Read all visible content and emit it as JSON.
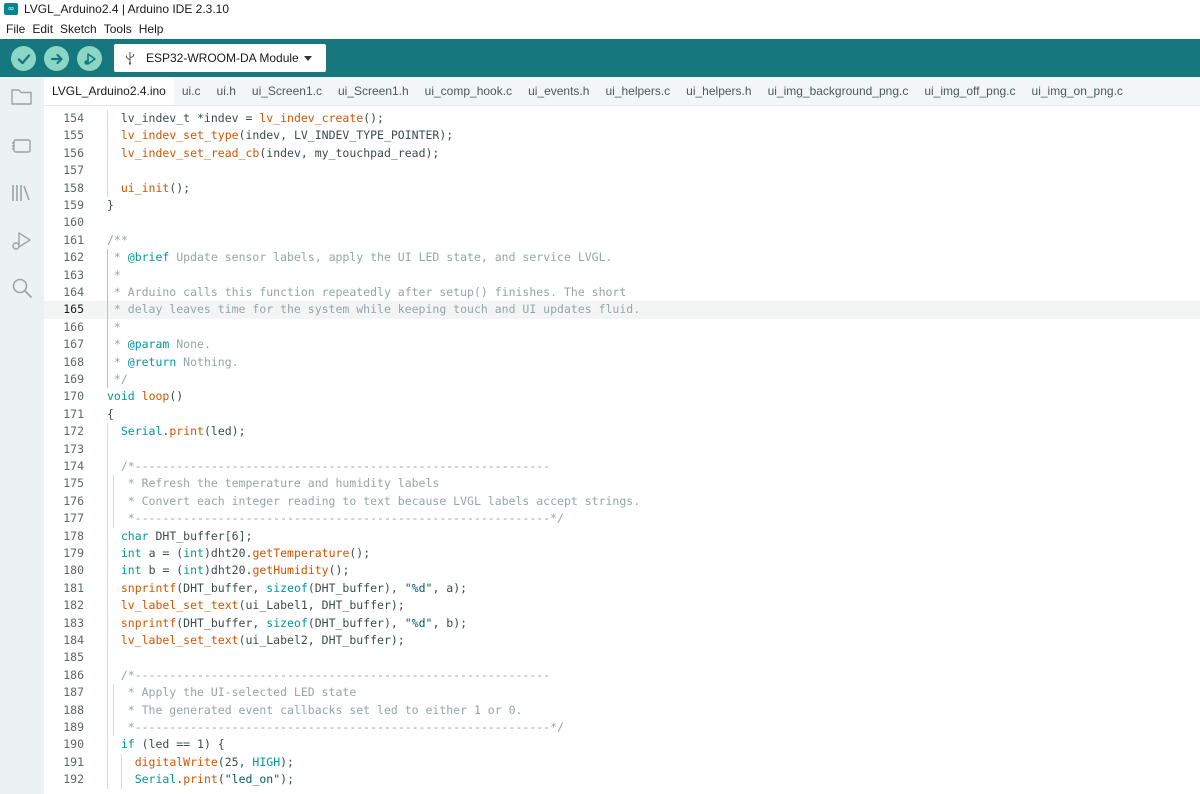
{
  "window": {
    "title": "LVGL_Arduino2.4 | Arduino IDE 2.3.10"
  },
  "menu": [
    "File",
    "Edit",
    "Sketch",
    "Tools",
    "Help"
  ],
  "toolbar": {
    "board": "ESP32-WROOM-DA Module"
  },
  "colors": {
    "toolbar": "#17777f",
    "button": "#8cd6c6",
    "keyword": "#00979d",
    "function": "#d35400",
    "comment": "#95a5a6"
  },
  "tabs": [
    "LVGL_Arduino2.4.ino",
    "ui.c",
    "ui.h",
    "ui_Screen1.c",
    "ui_Screen1.h",
    "ui_comp_hook.c",
    "ui_events.h",
    "ui_helpers.c",
    "ui_helpers.h",
    "ui_img_background_png.c",
    "ui_img_off_png.c",
    "ui_img_on_png.c"
  ],
  "active_tab": 0,
  "sidebar_icons": [
    "folder-icon",
    "board-icon",
    "library-icon",
    "debug-icon",
    "search-icon"
  ],
  "editor": {
    "current_line": 165,
    "lines": [
      {
        "n": "154",
        "indent": 1,
        "t": [
          [
            "  lv_indev_t *indev = ",
            ""
          ],
          [
            "lv_indev_create",
            "f"
          ],
          [
            "();",
            ""
          ]
        ]
      },
      {
        "n": "155",
        "indent": 1,
        "t": [
          [
            "  ",
            ""
          ],
          [
            "lv_indev_set_type",
            "f"
          ],
          [
            "(indev, LV_INDEV_TYPE_POINTER);",
            ""
          ]
        ]
      },
      {
        "n": "156",
        "indent": 1,
        "t": [
          [
            "  ",
            ""
          ],
          [
            "lv_indev_set_read_cb",
            "f"
          ],
          [
            "(indev, my_touchpad_read);",
            ""
          ]
        ]
      },
      {
        "n": "157",
        "indent": 1,
        "t": []
      },
      {
        "n": "158",
        "indent": 1,
        "t": [
          [
            "  ",
            ""
          ],
          [
            "ui_init",
            "f"
          ],
          [
            "();",
            ""
          ]
        ]
      },
      {
        "n": "159",
        "indent": 0,
        "t": [
          [
            "}",
            ""
          ]
        ]
      },
      {
        "n": "160",
        "indent": 0,
        "t": []
      },
      {
        "n": "161",
        "indent": 0,
        "t": [
          [
            "/**",
            "c"
          ]
        ]
      },
      {
        "n": "162",
        "indent": 2,
        "t": [
          [
            " * ",
            "c"
          ],
          [
            "@brief",
            "k"
          ],
          [
            " Update sensor labels, apply the UI LED state, and service LVGL.",
            "c"
          ]
        ]
      },
      {
        "n": "163",
        "indent": 2,
        "t": [
          [
            " *",
            "c"
          ]
        ]
      },
      {
        "n": "164",
        "indent": 2,
        "t": [
          [
            " * Arduino calls this function repeatedly after setup() finishes. The short",
            "c"
          ]
        ]
      },
      {
        "n": "165",
        "indent": 2,
        "t": [
          [
            " * delay leaves time for the system while keeping touch and UI updates fluid.",
            "c"
          ]
        ]
      },
      {
        "n": "166",
        "indent": 2,
        "t": [
          [
            " *",
            "c"
          ]
        ]
      },
      {
        "n": "167",
        "indent": 2,
        "t": [
          [
            " * ",
            "c"
          ],
          [
            "@param",
            "k"
          ],
          [
            " None.",
            "c"
          ]
        ]
      },
      {
        "n": "168",
        "indent": 2,
        "t": [
          [
            " * ",
            "c"
          ],
          [
            "@return",
            "k"
          ],
          [
            " Nothing.",
            "c"
          ]
        ]
      },
      {
        "n": "169",
        "indent": 2,
        "t": [
          [
            " */",
            "c"
          ]
        ]
      },
      {
        "n": "170",
        "indent": 0,
        "t": [
          [
            "void",
            "k"
          ],
          [
            " ",
            ""
          ],
          [
            "loop",
            "f"
          ],
          [
            "()",
            ""
          ]
        ]
      },
      {
        "n": "171",
        "indent": 0,
        "t": [
          [
            "{",
            ""
          ]
        ]
      },
      {
        "n": "172",
        "indent": 1,
        "t": [
          [
            "  ",
            ""
          ],
          [
            "Serial",
            "k"
          ],
          [
            ".",
            ""
          ],
          [
            "print",
            "f"
          ],
          [
            "(led);",
            ""
          ]
        ]
      },
      {
        "n": "173",
        "indent": 1,
        "t": []
      },
      {
        "n": "174",
        "indent": 1,
        "t": [
          [
            "  /*------------------------------------------------------------",
            "c"
          ]
        ]
      },
      {
        "n": "175",
        "indent": 3,
        "t": [
          [
            "   * Refresh the temperature and humidity labels",
            "c"
          ]
        ]
      },
      {
        "n": "176",
        "indent": 3,
        "t": [
          [
            "   * Convert each integer reading to text because LVGL labels accept strings.",
            "c"
          ]
        ]
      },
      {
        "n": "177",
        "indent": 3,
        "t": [
          [
            "   *------------------------------------------------------------*/",
            "c"
          ]
        ]
      },
      {
        "n": "178",
        "indent": 1,
        "t": [
          [
            "  ",
            ""
          ],
          [
            "char",
            "k"
          ],
          [
            " DHT_buffer[6];",
            ""
          ]
        ]
      },
      {
        "n": "179",
        "indent": 1,
        "t": [
          [
            "  ",
            ""
          ],
          [
            "int",
            "k"
          ],
          [
            " a = (",
            ""
          ],
          [
            "int",
            "k"
          ],
          [
            ")dht20.",
            ""
          ],
          [
            "getTemperature",
            "f"
          ],
          [
            "();",
            ""
          ]
        ]
      },
      {
        "n": "180",
        "indent": 1,
        "t": [
          [
            "  ",
            ""
          ],
          [
            "int",
            "k"
          ],
          [
            " b = (",
            ""
          ],
          [
            "int",
            "k"
          ],
          [
            ")dht20.",
            ""
          ],
          [
            "getHumidity",
            "f"
          ],
          [
            "();",
            ""
          ]
        ]
      },
      {
        "n": "181",
        "indent": 1,
        "t": [
          [
            "  ",
            ""
          ],
          [
            "snprintf",
            "f"
          ],
          [
            "(DHT_buffer, ",
            ""
          ],
          [
            "sizeof",
            "k"
          ],
          [
            "(DHT_buffer), ",
            ""
          ],
          [
            "\"%d\"",
            "s"
          ],
          [
            ", a);",
            ""
          ]
        ]
      },
      {
        "n": "182",
        "indent": 1,
        "t": [
          [
            "  ",
            ""
          ],
          [
            "lv_label_set_text",
            "f"
          ],
          [
            "(ui_Label1, DHT_buffer);",
            ""
          ]
        ]
      },
      {
        "n": "183",
        "indent": 1,
        "t": [
          [
            "  ",
            ""
          ],
          [
            "snprintf",
            "f"
          ],
          [
            "(DHT_buffer, ",
            ""
          ],
          [
            "sizeof",
            "k"
          ],
          [
            "(DHT_buffer), ",
            ""
          ],
          [
            "\"%d\"",
            "s"
          ],
          [
            ", b);",
            ""
          ]
        ]
      },
      {
        "n": "184",
        "indent": 1,
        "t": [
          [
            "  ",
            ""
          ],
          [
            "lv_label_set_text",
            "f"
          ],
          [
            "(ui_Label2, DHT_buffer);",
            ""
          ]
        ]
      },
      {
        "n": "185",
        "indent": 1,
        "t": []
      },
      {
        "n": "186",
        "indent": 1,
        "t": [
          [
            "  /*------------------------------------------------------------",
            "c"
          ]
        ]
      },
      {
        "n": "187",
        "indent": 3,
        "t": [
          [
            "   * Apply the UI-selected LED state",
            "c"
          ]
        ]
      },
      {
        "n": "188",
        "indent": 3,
        "t": [
          [
            "   * The generated event callbacks set led to either 1 or 0.",
            "c"
          ]
        ]
      },
      {
        "n": "189",
        "indent": 3,
        "t": [
          [
            "   *------------------------------------------------------------*/",
            "c"
          ]
        ]
      },
      {
        "n": "190",
        "indent": 1,
        "t": [
          [
            "  ",
            ""
          ],
          [
            "if",
            "k"
          ],
          [
            " (led == 1) {",
            ""
          ]
        ]
      },
      {
        "n": "191",
        "indent": 4,
        "t": [
          [
            "    ",
            ""
          ],
          [
            "digitalWrite",
            "f"
          ],
          [
            "(25, ",
            ""
          ],
          [
            "HIGH",
            "cn"
          ],
          [
            ");",
            ""
          ]
        ]
      },
      {
        "n": "192",
        "indent": 4,
        "t": [
          [
            "    ",
            ""
          ],
          [
            "Serial",
            "k"
          ],
          [
            ".",
            ""
          ],
          [
            "print",
            "f"
          ],
          [
            "(",
            ""
          ],
          [
            "\"led_on\"",
            "s"
          ],
          [
            ");",
            ""
          ]
        ]
      }
    ]
  }
}
